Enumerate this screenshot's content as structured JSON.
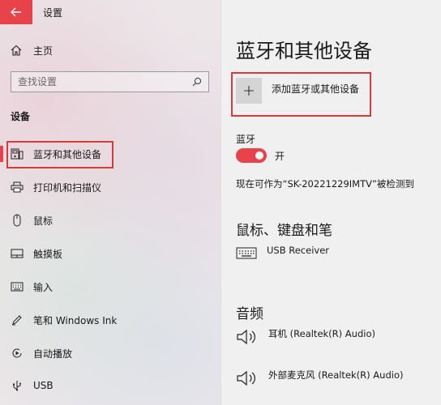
{
  "window": {
    "title": "设置"
  },
  "sidebar": {
    "home_label": "主页",
    "search_placeholder": "查找设置",
    "section_heading": "设备",
    "items": [
      {
        "label": "蓝牙和其他设备",
        "icon": "bluetooth-devices-icon",
        "active": true
      },
      {
        "label": "打印机和扫描仪",
        "icon": "printer-icon"
      },
      {
        "label": "鼠标",
        "icon": "mouse-icon"
      },
      {
        "label": "触摸板",
        "icon": "touchpad-icon"
      },
      {
        "label": "输入",
        "icon": "keyboard-icon"
      },
      {
        "label": "笔和 Windows Ink",
        "icon": "pen-icon"
      },
      {
        "label": "自动播放",
        "icon": "autoplay-icon"
      },
      {
        "label": "USB",
        "icon": "usb-icon"
      }
    ]
  },
  "main": {
    "title": "蓝牙和其他设备",
    "add_device_label": "添加蓝牙或其他设备",
    "bluetooth_label": "蓝牙",
    "bluetooth_state": "开",
    "discoverable_text": "现在可作为“SK-20221229IMTV”被检测到",
    "mouse_keyboard_section": {
      "title": "鼠标、键盘和笔",
      "devices": [
        {
          "name": "USB Receiver",
          "icon": "keyboard-icon"
        }
      ]
    },
    "audio_section": {
      "title": "音频",
      "devices": [
        {
          "name": "耳机 (Realtek(R) Audio)",
          "icon": "speaker-icon"
        },
        {
          "name": "外部麦克风 (Realtek(R) Audio)",
          "icon": "speaker-icon"
        }
      ]
    }
  },
  "colors": {
    "accent": "#e8424b",
    "highlight_box": "#d63b3b"
  }
}
